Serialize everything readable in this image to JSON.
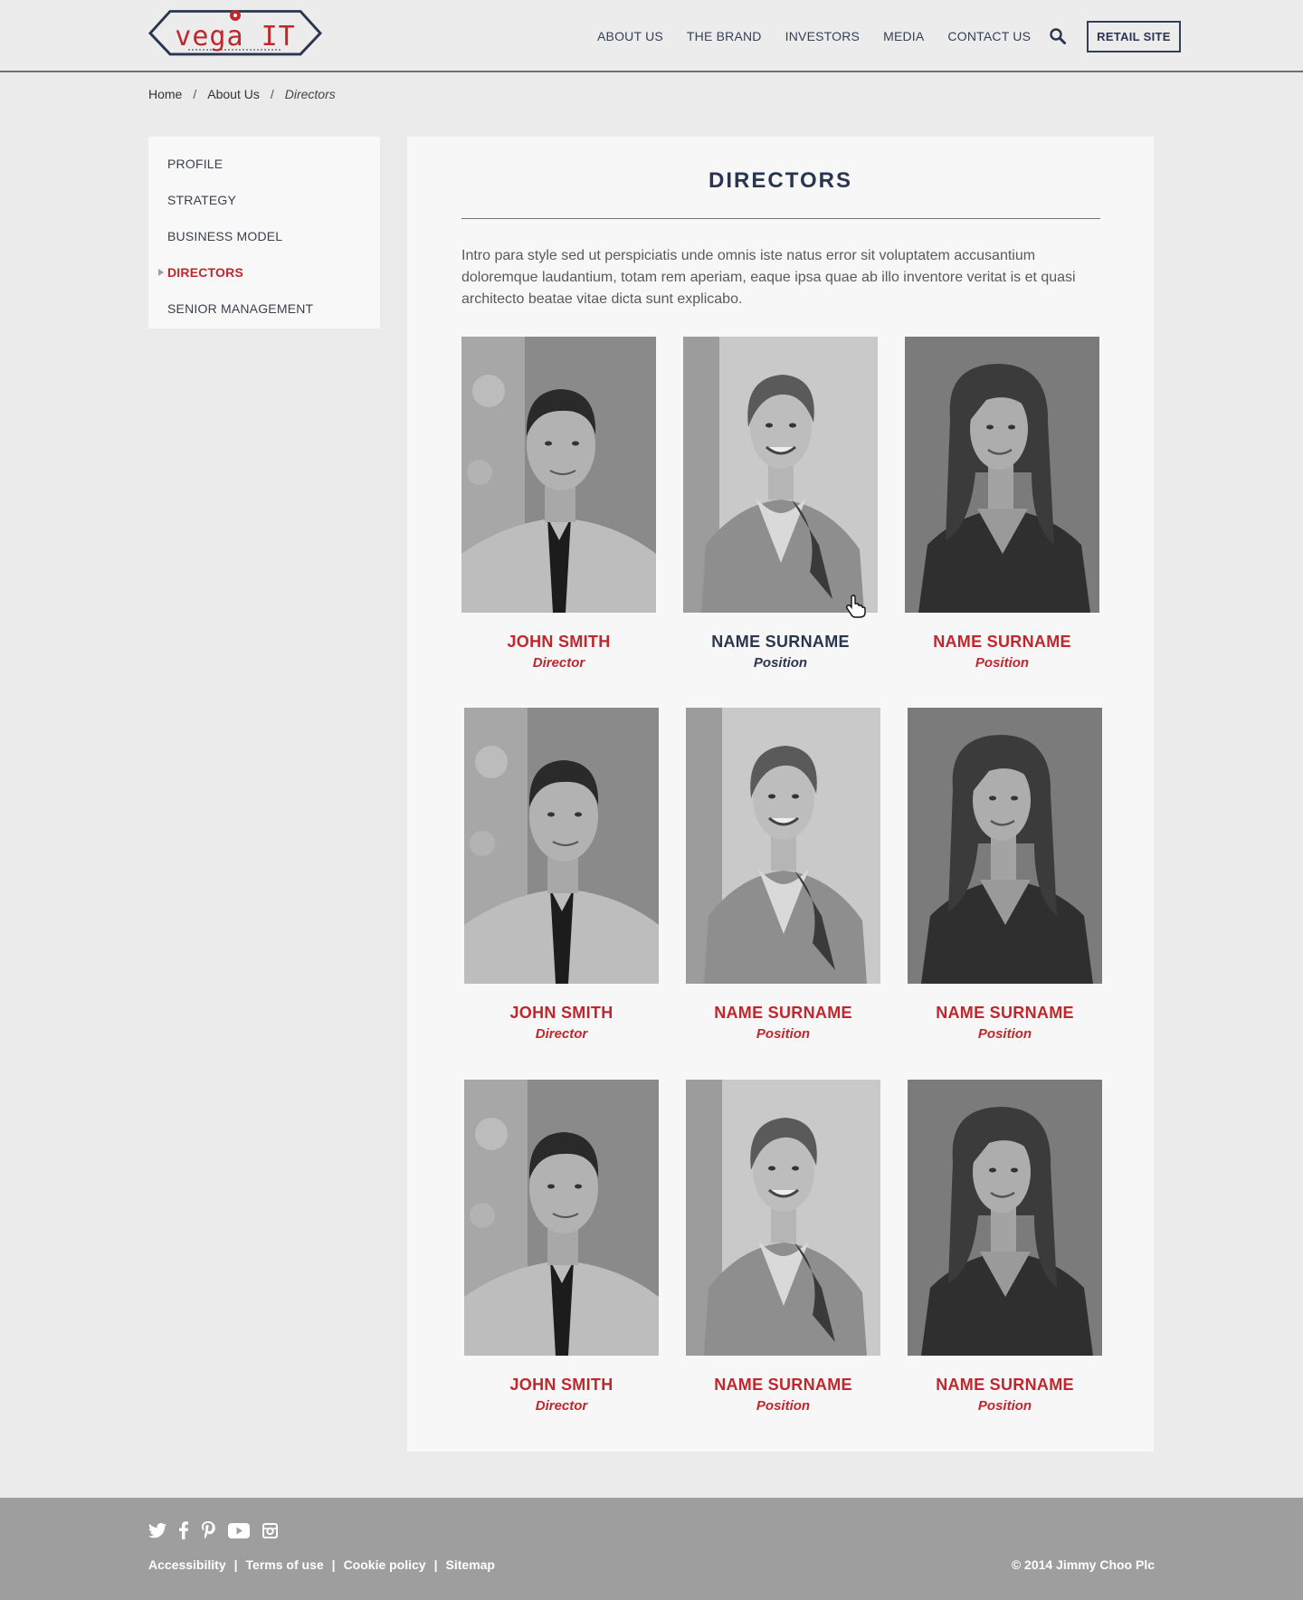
{
  "header": {
    "logo_text": "vega IT",
    "nav": [
      "ABOUT US",
      "THE BRAND",
      "INVESTORS",
      "MEDIA",
      "CONTACT US"
    ],
    "retail_label": "RETAIL SITE"
  },
  "breadcrumb": {
    "home": "Home",
    "about": "About Us",
    "current": "Directors",
    "separator": "/"
  },
  "sidebar": {
    "items": [
      {
        "label": "PROFILE"
      },
      {
        "label": "STRATEGY"
      },
      {
        "label": "BUSINESS MODEL"
      },
      {
        "label": "DIRECTORS",
        "active": true
      },
      {
        "label": "SENIOR MANAGEMENT"
      }
    ]
  },
  "main": {
    "title": "DIRECTORS",
    "intro": "Intro para style sed ut perspiciatis unde omnis iste natus error sit voluptatem accusantium doloremque laudantium, totam rem aperiam, eaque ipsa quae ab illo inventore veritat is et quasi architecto beatae vitae dicta sunt explicabo.",
    "directors": [
      {
        "name": "JOHN SMITH",
        "position": "Director",
        "photo": "man"
      },
      {
        "name": "NAME SURNAME",
        "position": "Position",
        "photo": "woman-short-hair",
        "hovered": true
      },
      {
        "name": "NAME SURNAME",
        "position": "Position",
        "photo": "woman-long-hair"
      },
      {
        "name": "JOHN SMITH",
        "position": "Director",
        "photo": "man"
      },
      {
        "name": "NAME SURNAME",
        "position": "Position",
        "photo": "woman-short-hair"
      },
      {
        "name": "NAME SURNAME",
        "position": "Position",
        "photo": "woman-long-hair"
      },
      {
        "name": "JOHN SMITH",
        "position": "Director",
        "photo": "man"
      },
      {
        "name": "NAME SURNAME",
        "position": "Position",
        "photo": "woman-short-hair"
      },
      {
        "name": "NAME SURNAME",
        "position": "Position",
        "photo": "woman-long-hair"
      }
    ]
  },
  "footer": {
    "social_icons": [
      "twitter-icon",
      "facebook-icon",
      "pinterest-icon",
      "youtube-icon",
      "instagram-icon"
    ],
    "links": [
      "Accessibility",
      "Terms of use",
      "Cookie policy",
      "Sitemap"
    ],
    "copyright": "© 2014 Jimmy Choo Plc"
  },
  "colors": {
    "accent_red": "#c0272d",
    "navy": "#2a3550",
    "footer_bg": "#9e9e9e"
  }
}
